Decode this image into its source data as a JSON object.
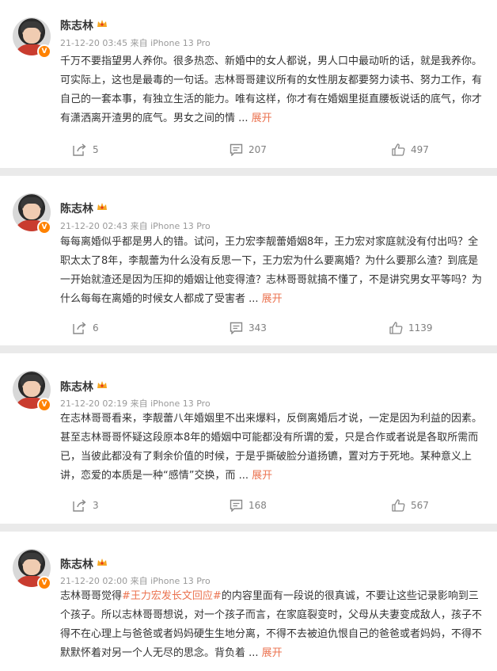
{
  "posts": [
    {
      "author": "陈志林",
      "meta": "21-12-20 03:45  来自 iPhone 13 Pro",
      "text": "千万不要指望男人养你。很多热恋、新婚中的女人都说，男人口中最动听的话，就是我养你。可实际上，这也是最毒的一句话。志林哥哥建议所有的女性朋友都要努力读书、努力工作，有自己的一套本事，有独立生活的能力。唯有这样，你才有在婚姻里挺直腰板说话的底气，你才有潇洒离开渣男的底气。男女之间的情 ...",
      "hashtag": "",
      "pre": "",
      "post_text": "",
      "expand": "展开",
      "shares": "5",
      "comments": "207",
      "likes": "497"
    },
    {
      "author": "陈志林",
      "meta": "21-12-20 02:43  来自 iPhone 13 Pro",
      "text": "每每离婚似乎都是男人的错。试问，王力宏李靓蕾婚姻8年，王力宏对家庭就没有付出吗？全职太太了8年，李靓蕾为什么没有反思一下，王力宏为什么要离婚？为什么要那么渣？到底是一开始就渣还是因为压抑的婚姻让他变得渣？志林哥哥就搞不懂了，不是讲究男女平等吗？为什么每每在离婚的时候女人都成了受害者 ...",
      "hashtag": "",
      "pre": "",
      "post_text": "",
      "expand": "展开",
      "shares": "6",
      "comments": "343",
      "likes": "1139"
    },
    {
      "author": "陈志林",
      "meta": "21-12-20 02:19  来自 iPhone 13 Pro",
      "text": "在志林哥哥看来，李靓蕾八年婚姻里不出来爆料，反倒离婚后才说，一定是因为利益的因素。甚至志林哥哥怀疑这段原本8年的婚姻中可能都没有所谓的爱，只是合作或者说是各取所需而已，当彼此都没有了剩余价值的时候，于是乎撕破脸分道扬镳，置对方于死地。某种意义上讲，恋爱的本质是一种“感情”交换，而 ...",
      "hashtag": "",
      "pre": "",
      "post_text": "",
      "expand": "展开",
      "shares": "3",
      "comments": "168",
      "likes": "567"
    },
    {
      "author": "陈志林",
      "meta": "21-12-20 02:00  来自 iPhone 13 Pro",
      "text": "",
      "pre": "志林哥哥觉得",
      "hashtag": "#王力宏发长文回应#",
      "post_text": "的内容里面有一段说的很真诚，不要让这些记录影响到三个孩子。所以志林哥哥想说，对一个孩子而言，在家庭裂变时，父母从夫妻变成敌人，孩子不得不在心理上与爸爸或者妈妈硬生生地分离，不得不去被迫仇恨自己的爸爸或者妈妈，不得不默默怀着对另一个人无尽的思念。背负着 ...",
      "expand": "展开",
      "shares": "",
      "comments": "",
      "likes": ""
    }
  ]
}
